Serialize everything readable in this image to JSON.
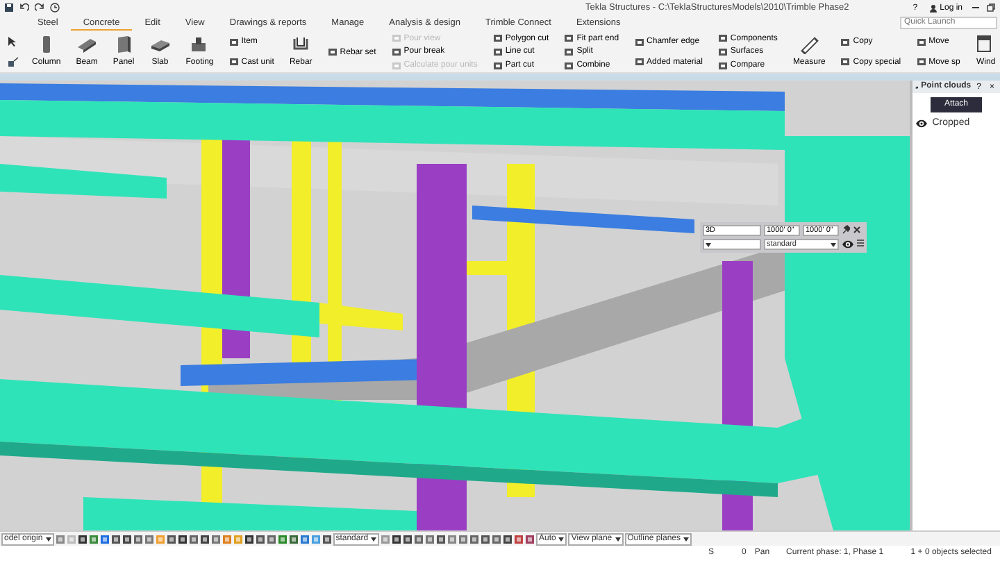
{
  "title_bar": {
    "title": "Tekla Structures - C:\\TeklaStructuresModels\\2010\\Trimble Phase2",
    "help": "?",
    "login": "Log in"
  },
  "tabs": [
    {
      "label": "Steel",
      "selected": false
    },
    {
      "label": "Concrete",
      "selected": true
    },
    {
      "label": "Edit",
      "selected": false
    },
    {
      "label": "View",
      "selected": false
    },
    {
      "label": "Drawings & reports",
      "selected": false
    },
    {
      "label": "Manage",
      "selected": false
    },
    {
      "label": "Analysis & design",
      "selected": false
    },
    {
      "label": "Trimble Connect",
      "selected": false
    },
    {
      "label": "Extensions",
      "selected": false
    }
  ],
  "quick_launch": {
    "placeholder": "Quick Launch"
  },
  "ribbon": [
    {
      "kind": "large",
      "items": [
        {
          "label": "Column",
          "disabled": false
        }
      ]
    },
    {
      "kind": "large",
      "items": [
        {
          "label": "Beam",
          "disabled": false
        }
      ]
    },
    {
      "kind": "large",
      "items": [
        {
          "label": "Panel",
          "disabled": false
        }
      ]
    },
    {
      "kind": "large",
      "items": [
        {
          "label": "Slab",
          "disabled": false
        }
      ]
    },
    {
      "kind": "large",
      "items": [
        {
          "label": "Footing",
          "disabled": false
        }
      ]
    },
    {
      "kind": "stack",
      "items": [
        {
          "label": "Item",
          "disabled": false
        },
        {
          "label": "Cast unit",
          "disabled": false
        }
      ]
    },
    {
      "kind": "large",
      "items": [
        {
          "label": "Rebar",
          "disabled": false
        }
      ]
    },
    {
      "kind": "stack",
      "items": [
        {
          "label": "Rebar set",
          "disabled": false
        }
      ]
    },
    {
      "kind": "stack",
      "items": [
        {
          "label": "Pour view",
          "disabled": true
        },
        {
          "label": "Pour break",
          "disabled": false
        },
        {
          "label": "Calculate pour units",
          "disabled": true
        }
      ]
    },
    {
      "kind": "stack",
      "items": [
        {
          "label": "Polygon cut",
          "disabled": false
        },
        {
          "label": "Line cut",
          "disabled": false
        },
        {
          "label": "Part cut",
          "disabled": false
        }
      ]
    },
    {
      "kind": "stack",
      "items": [
        {
          "label": "Fit part end",
          "disabled": false
        },
        {
          "label": "Split",
          "disabled": false
        },
        {
          "label": "Combine",
          "disabled": false
        }
      ]
    },
    {
      "kind": "stack",
      "items": [
        {
          "label": "Chamfer edge",
          "disabled": false
        },
        {
          "label": "Added material",
          "disabled": false
        }
      ]
    },
    {
      "kind": "stack",
      "items": [
        {
          "label": "Components",
          "disabled": false
        },
        {
          "label": "Surfaces",
          "disabled": false
        },
        {
          "label": "Compare",
          "disabled": false
        }
      ]
    },
    {
      "kind": "large",
      "items": [
        {
          "label": "Measure",
          "disabled": false
        }
      ]
    },
    {
      "kind": "stack",
      "items": [
        {
          "label": "Copy",
          "disabled": false
        },
        {
          "label": "Copy special",
          "disabled": false
        }
      ]
    },
    {
      "kind": "stack",
      "items": [
        {
          "label": "Move",
          "disabled": false
        },
        {
          "label": "Move sp",
          "disabled": false
        }
      ]
    },
    {
      "kind": "large",
      "items": [
        {
          "label": "Wind",
          "disabled": false
        }
      ]
    }
  ],
  "view_dialog": {
    "view_name": "3D",
    "depth_up": "1000' 0\"",
    "depth_down": "1000' 0\"",
    "representation": "standard"
  },
  "point_clouds": {
    "title": "Point clouds",
    "help": "?",
    "close": "×",
    "attach": "Attach",
    "items": [
      {
        "name": "Cropped",
        "visible": true
      }
    ]
  },
  "toolbar": {
    "origin": "odel origin",
    "selection_filter": "standard",
    "snap_depth": "Auto",
    "view_plane": "View plane",
    "outline_planes": "Outline planes"
  },
  "status_bar": {
    "mode": "S",
    "count": "0",
    "action": "Pan",
    "phase": "Current phase: 1, Phase 1",
    "selection": "1 + 0 objects selected"
  }
}
